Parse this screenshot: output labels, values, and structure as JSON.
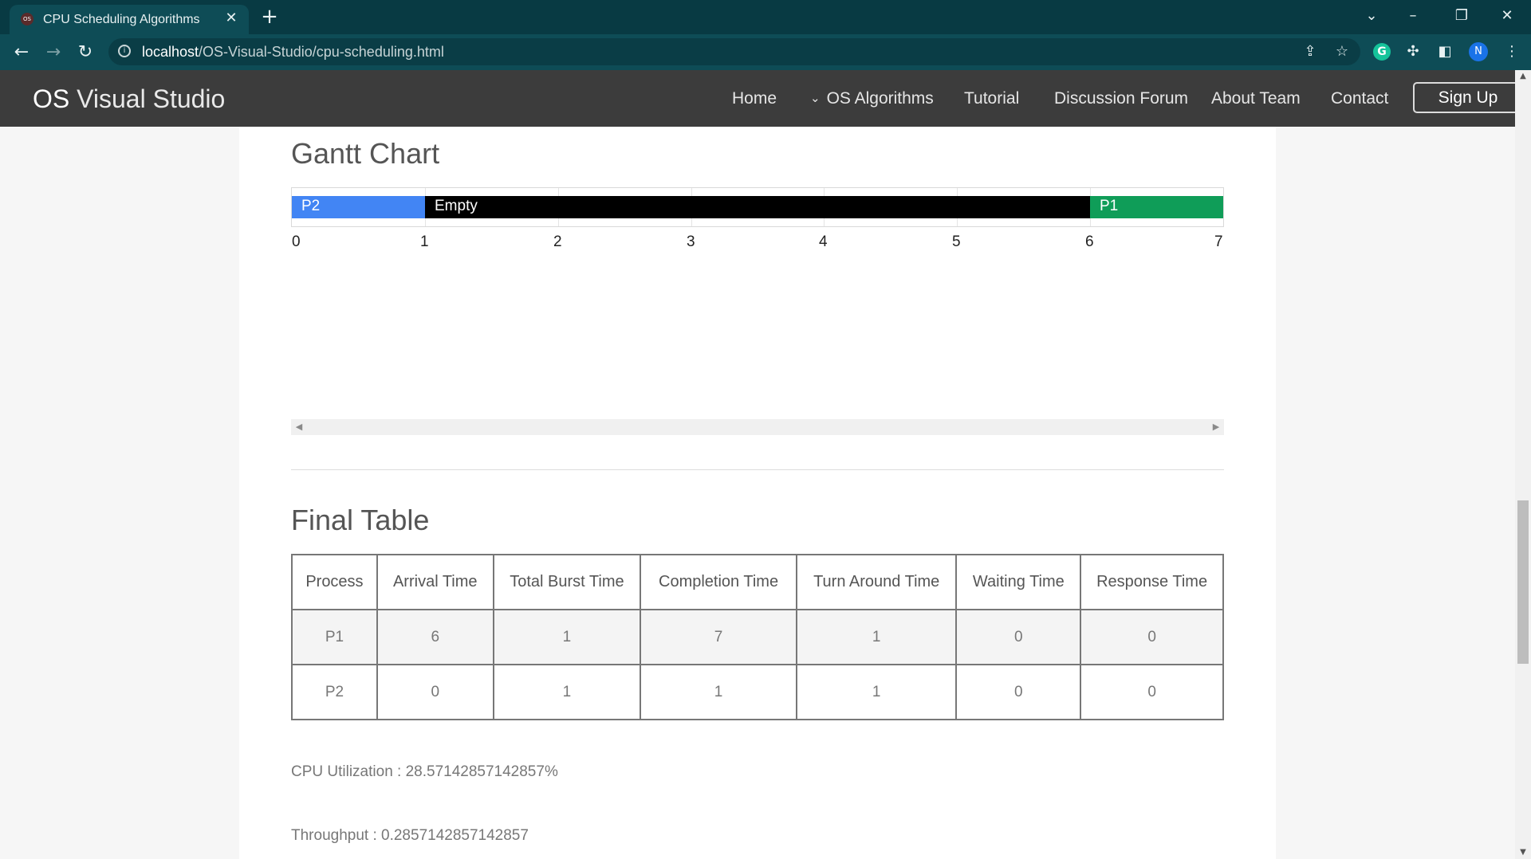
{
  "browser": {
    "tab_title": "CPU Scheduling Algorithms",
    "favicon_text": "OS",
    "url_host": "localhost",
    "url_path": "/OS-Visual-Studio/cpu-scheduling.html",
    "profile_initial": "N",
    "extension_letter": "G"
  },
  "navbar": {
    "brand_strong": "OS",
    "brand_rest": " Visual Studio",
    "links": [
      "Home",
      "OS Algorithms",
      "Tutorial",
      "Discussion Forum",
      "About Team",
      "Contact"
    ],
    "signup_label": "Sign Up"
  },
  "gantt": {
    "title": "Gantt Chart",
    "total_time": 7,
    "blocks": [
      {
        "label": "P2",
        "start": 0,
        "end": 1,
        "color": "#4285f4"
      },
      {
        "label": "Empty",
        "start": 1,
        "end": 6,
        "color": "#000000"
      },
      {
        "label": "P1",
        "start": 6,
        "end": 7,
        "color": "#0f9d58"
      }
    ],
    "ticks": [
      "0",
      "1",
      "2",
      "3",
      "4",
      "5",
      "6",
      "7"
    ]
  },
  "final_table": {
    "title": "Final Table",
    "headers": [
      "Process",
      "Arrival Time",
      "Total Burst Time",
      "Completion Time",
      "Turn Around Time",
      "Waiting Time",
      "Response Time"
    ],
    "rows": [
      [
        "P1",
        "6",
        "1",
        "7",
        "1",
        "0",
        "0"
      ],
      [
        "P2",
        "0",
        "1",
        "1",
        "1",
        "0",
        "0"
      ]
    ]
  },
  "stats": {
    "cpu_utilization": "CPU Utilization : 28.57142857142857%",
    "throughput": "Throughput : 0.2857142857142857"
  }
}
